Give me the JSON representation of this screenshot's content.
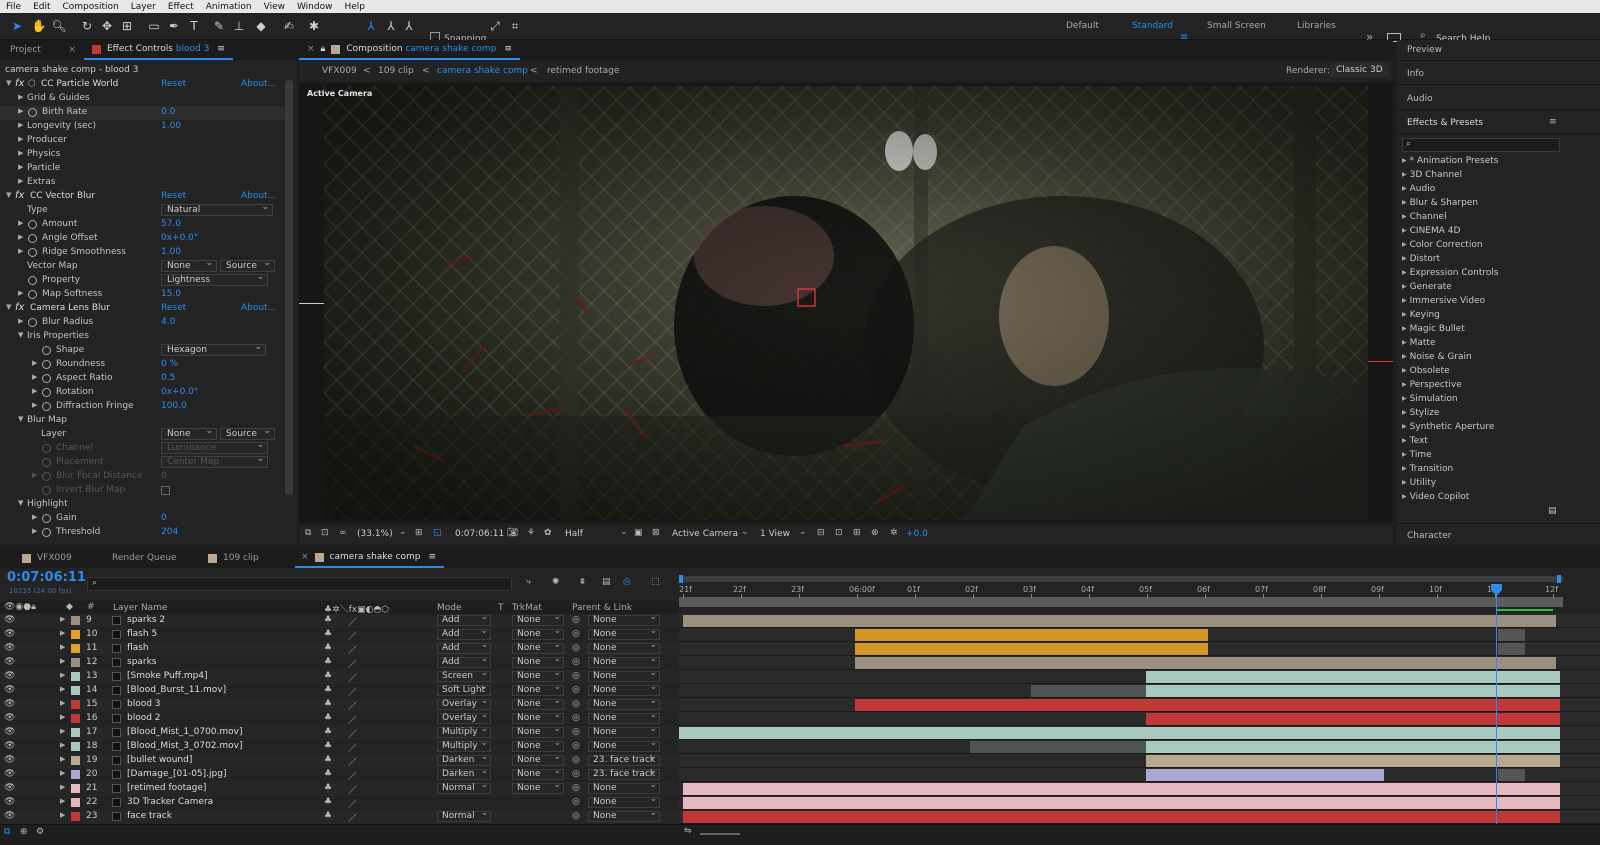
{
  "menu": [
    "File",
    "Edit",
    "Composition",
    "Layer",
    "Effect",
    "Animation",
    "View",
    "Window",
    "Help"
  ],
  "toolbar": {
    "snapping_label": "Snapping",
    "workspaces": [
      "Default",
      "Standard",
      "Small Screen",
      "Libraries"
    ],
    "active_workspace": "Standard",
    "search_help": "Search Help"
  },
  "left_panel": {
    "tabs": {
      "project": "Project",
      "effect_controls": "Effect Controls",
      "layer": "blood 3"
    },
    "header": "camera shake comp - blood 3",
    "effects": [
      {
        "name": "CC Particle World",
        "reset": "Reset",
        "about": "About..."
      },
      {
        "name": "CC Vector Blur",
        "reset": "Reset",
        "about": "About..."
      },
      {
        "name": "Camera Lens Blur",
        "reset": "Reset",
        "about": "About..."
      }
    ],
    "particle": {
      "grid": "Grid & Guides",
      "birth_rate": "Birth Rate",
      "birth_rate_val": "0.0",
      "longevity": "Longevity (sec)",
      "longevity_val": "1.00",
      "producer": "Producer",
      "physics": "Physics",
      "particle": "Particle",
      "extras": "Extras"
    },
    "vector": {
      "type": "Type",
      "type_val": "Natural",
      "amount": "Amount",
      "amount_val": "57.0",
      "angle": "Angle Offset",
      "angle_val": "0x+0.0°",
      "ridge": "Ridge Smoothness",
      "ridge_val": "1.00",
      "vector_map": "Vector Map",
      "vm_val": "None",
      "vm_src": "Source",
      "property": "Property",
      "property_val": "Lightness",
      "softness": "Map Softness",
      "softness_val": "15.0"
    },
    "lens": {
      "blur_radius": "Blur Radius",
      "blur_radius_val": "4.0",
      "iris": "Iris Properties",
      "shape": "Shape",
      "shape_val": "Hexagon",
      "roundness": "Roundness",
      "roundness_val": "0 %",
      "aspect": "Aspect Ratio",
      "aspect_val": "0.5",
      "rotation": "Rotation",
      "rotation_val": "0x+0.0°",
      "diff": "Diffraction Fringe",
      "diff_val": "100.0",
      "blur_map": "Blur Map",
      "layer": "Layer",
      "layer_val": "None",
      "layer_src": "Source",
      "channel": "Channel",
      "channel_val": "Luminance",
      "placement": "Placement",
      "placement_val": "Center Map",
      "focal": "Blur Focal Distance",
      "focal_val": "0",
      "invert": "Invert Blur Map",
      "highlight": "Highlight",
      "gain": "Gain",
      "gain_val": "0",
      "threshold": "Threshold",
      "threshold_val": "204"
    }
  },
  "comp": {
    "tab_prefix": "Composition",
    "tab_name": "camera shake comp",
    "breadcrumbs": [
      "VFX009",
      "109 clip",
      "camera shake comp",
      "retimed footage"
    ],
    "renderer_label": "Renderer:",
    "renderer": "Classic 3D",
    "viewer_label": "Active Camera",
    "footer": {
      "zoom": "(33.1%)",
      "time": "0:07:06:11",
      "resolution": "Half",
      "camera": "Active Camera",
      "views": "1 View",
      "exposure": "+0.0"
    }
  },
  "right_panel": {
    "preview": "Preview",
    "info": "Info",
    "audio": "Audio",
    "effects_presets": "Effects & Presets",
    "character": "Character",
    "categories": [
      "* Animation Presets",
      "3D Channel",
      "Audio",
      "Blur & Sharpen",
      "Channel",
      "CINEMA 4D",
      "Color Correction",
      "Distort",
      "Expression Controls",
      "Generate",
      "Immersive Video",
      "Keying",
      "Magic Bullet",
      "Matte",
      "Noise & Grain",
      "Obsolete",
      "Perspective",
      "Simulation",
      "Stylize",
      "Synthetic Aperture",
      "Text",
      "Time",
      "Transition",
      "Utility",
      "Video Copilot"
    ]
  },
  "timeline": {
    "tabs": [
      "VFX009",
      "Render Queue",
      "109 clip",
      "camera shake comp"
    ],
    "timecode": "0:07:06:11",
    "frames": "10235 (24.00 fps)",
    "columns": {
      "layer_name": "Layer Name",
      "mode": "Mode",
      "t": "T",
      "trkmat": "TrkMat",
      "parent": "Parent & Link"
    },
    "ruler": [
      "21f",
      "22f",
      "23f",
      "06:00f",
      "01f",
      "02f",
      "03f",
      "04f",
      "05f",
      "06f",
      "07f",
      "08f",
      "09f",
      "10f",
      "11f",
      "12f"
    ],
    "layers": [
      {
        "num": "9",
        "name": "sparks 2",
        "mode": "Add",
        "trk": "None",
        "parent": "None",
        "color": "#9b8f80"
      },
      {
        "num": "10",
        "name": "flash 5",
        "mode": "Add",
        "trk": "None",
        "parent": "None",
        "color": "#e0a030"
      },
      {
        "num": "11",
        "name": "flash",
        "mode": "Add",
        "trk": "None",
        "parent": "None",
        "color": "#e0a030"
      },
      {
        "num": "12",
        "name": "sparks",
        "mode": "Add",
        "trk": "None",
        "parent": "None",
        "color": "#9b8f80"
      },
      {
        "num": "13",
        "name": "[Smoke Puff.mp4]",
        "mode": "Screen",
        "trk": "None",
        "parent": "None",
        "color": "#a8c8c0"
      },
      {
        "num": "14",
        "name": "[Blood_Burst_11.mov]",
        "mode": "Soft Light",
        "trk": "None",
        "parent": "None",
        "color": "#a8c8c0"
      },
      {
        "num": "15",
        "name": "blood 3",
        "mode": "Overlay",
        "trk": "None",
        "parent": "None",
        "color": "#c03838"
      },
      {
        "num": "16",
        "name": "blood 2",
        "mode": "Overlay",
        "trk": "None",
        "parent": "None",
        "color": "#c03838"
      },
      {
        "num": "17",
        "name": "[Blood_Mist_1_0700.mov]",
        "mode": "Multiply",
        "trk": "None",
        "parent": "None",
        "color": "#a8c8c0"
      },
      {
        "num": "18",
        "name": "[Blood_Mist_3_0702.mov]",
        "mode": "Multiply",
        "trk": "None",
        "parent": "None",
        "color": "#a8c8c0"
      },
      {
        "num": "19",
        "name": "[bullet wound]",
        "mode": "Darken",
        "trk": "None",
        "parent": "23. face track",
        "color": "#b8a890"
      },
      {
        "num": "20",
        "name": "[Damage_[01-05].jpg]",
        "mode": "Darken",
        "trk": "None",
        "parent": "23. face track",
        "color": "#a8a8d0"
      },
      {
        "num": "21",
        "name": "[retimed footage]",
        "mode": "Normal",
        "trk": "None",
        "parent": "None",
        "color": "#e8b8c0"
      },
      {
        "num": "22",
        "name": "3D Tracker Camera",
        "mode": "",
        "trk": "",
        "parent": "None",
        "color": "#e8b8c0"
      },
      {
        "num": "23",
        "name": "face track",
        "mode": "Normal",
        "trk": "",
        "parent": "None",
        "color": "#c03838"
      }
    ]
  },
  "colors": {
    "accent": "#2d8ceb",
    "panel": "#232323",
    "bg": "#1d1d1d"
  }
}
